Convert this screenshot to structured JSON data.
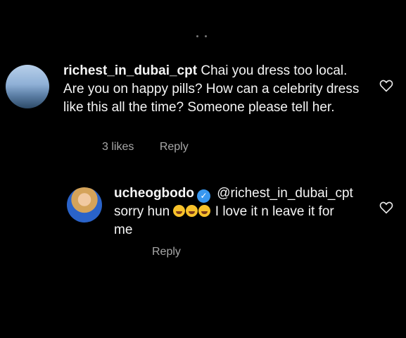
{
  "comments": [
    {
      "username": "richest_in_dubai_cpt",
      "text": "Chai you dress too local. Are you on happy pills? How can a celebrity dress like this all the time?  Someone please tell her.",
      "likes": "3 likes",
      "reply_label": "Reply",
      "avatar_icon": "city-skyline-avatar"
    },
    {
      "username": "ucheogbodo",
      "verified": true,
      "mention": "@richest_in_dubai_cpt",
      "text_before_emoji": "sorry hun",
      "emoji": "😂😂😂",
      "text_after_emoji": "I love it n leave it for me",
      "reply_label": "Reply",
      "avatar_icon": "profile-photo-avatar"
    }
  ],
  "colors": {
    "background": "#000000",
    "text": "#f5f5f5",
    "meta": "#a8a8a8",
    "verified": "#3897f0"
  }
}
